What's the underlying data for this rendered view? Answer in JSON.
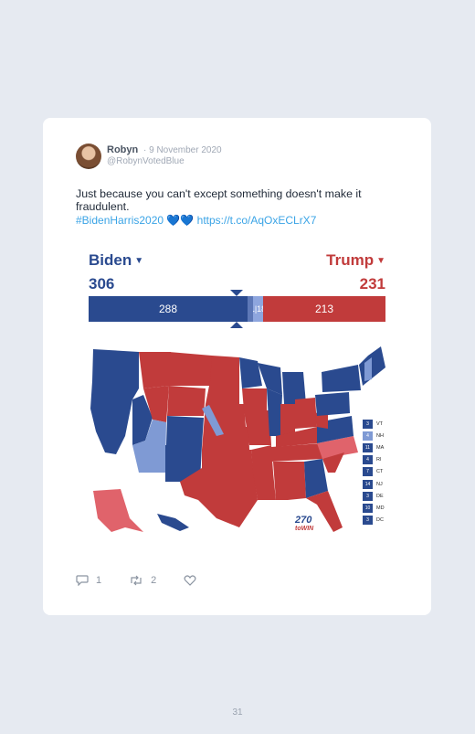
{
  "tweet": {
    "author": "Robyn",
    "date": "· 9 November 2020",
    "handle": "@RobynVotedBlue",
    "text": "Just because you can't except something doesn't make it fraudulent.",
    "hashtag": "#BidenHarris2020",
    "hearts": "💙💙",
    "link": "https://t.co/AqOxECLrX7"
  },
  "embed": {
    "biden_label": "Biden",
    "trump_label": "Trump",
    "biden_total": "306",
    "trump_total": "231",
    "bar": {
      "biden_safe": "288",
      "biden_lean": "1",
      "trump_lean": "18",
      "trump_safe": "213"
    },
    "logo_number": "270",
    "logo_text": "toWIN",
    "ne_states": [
      {
        "label": "VT",
        "value": "3",
        "color": "#2a4a8f"
      },
      {
        "label": "NH",
        "value": "4",
        "color": "#7f9ad4"
      },
      {
        "label": "MA",
        "value": "11",
        "color": "#2a4a8f"
      },
      {
        "label": "RI",
        "value": "4",
        "color": "#2a4a8f"
      },
      {
        "label": "CT",
        "value": "7",
        "color": "#2a4a8f"
      },
      {
        "label": "NJ",
        "value": "14",
        "color": "#2a4a8f"
      },
      {
        "label": "DE",
        "value": "3",
        "color": "#2a4a8f"
      },
      {
        "label": "MD",
        "value": "10",
        "color": "#2a4a8f"
      },
      {
        "label": "DC",
        "value": "3",
        "color": "#2a4a8f"
      }
    ]
  },
  "actions": {
    "reply_count": "1",
    "retweet_count": "2"
  },
  "page_number": "31",
  "colors": {
    "dem": "#2a4a8f",
    "dem_lean": "#7f9ad4",
    "gop": "#c13b3b",
    "gop_lean": "#e0636b"
  }
}
